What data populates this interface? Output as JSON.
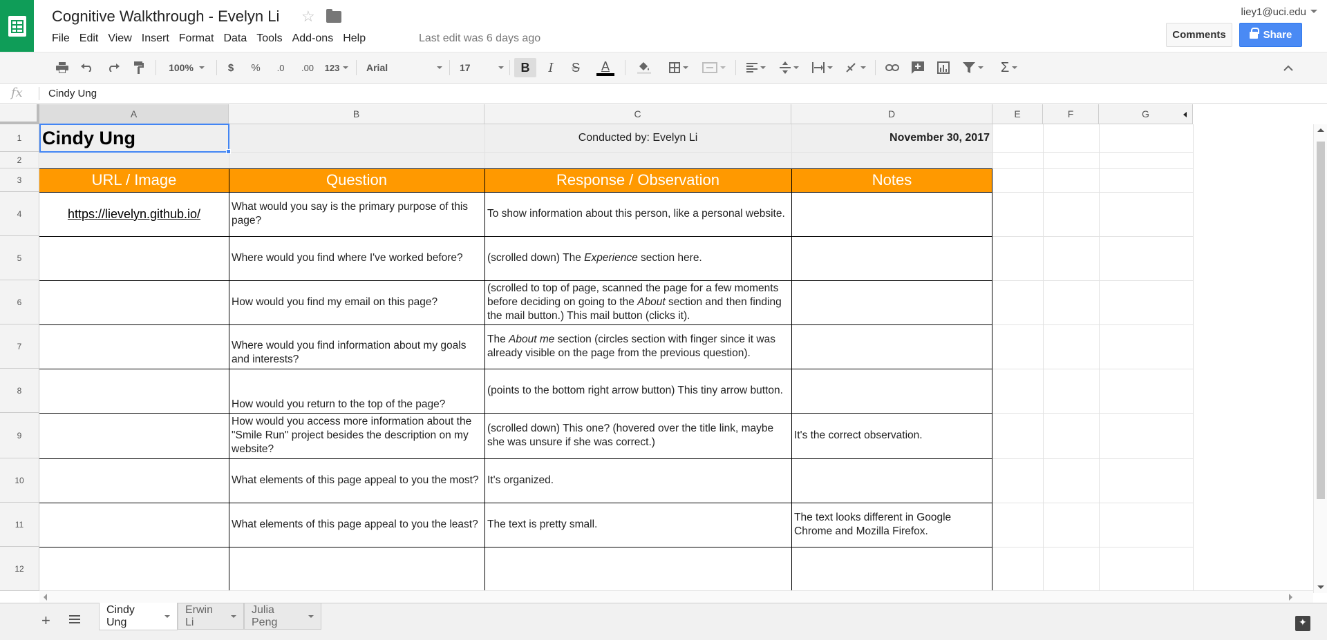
{
  "window": {
    "doc_title": "Cognitive Walkthrough - Evelyn Li",
    "last_edit": "Last edit was 6 days ago",
    "account": "liey1@uci.edu",
    "comments_label": "Comments",
    "share_label": "Share",
    "brand_color": "#0f9d58",
    "share_color": "#4a8af4"
  },
  "menu": [
    "File",
    "Edit",
    "View",
    "Insert",
    "Format",
    "Data",
    "Tools",
    "Add-ons",
    "Help"
  ],
  "toolbar": {
    "zoom": "100%",
    "currency": "$",
    "percent": "%",
    "decrease_decimal": ".0",
    "increase_decimal": ".00",
    "more_formats": "123",
    "font": "Arial",
    "font_size": "17",
    "bold": "B",
    "italic": "I",
    "strikethrough": "S",
    "text_color": "A",
    "bold_active": true
  },
  "formula_bar": {
    "fx": "fx",
    "value": "Cindy Ung"
  },
  "columns": [
    "A",
    "B",
    "C",
    "D",
    "E",
    "F",
    "G"
  ],
  "rows": [
    "1",
    "2",
    "3",
    "4",
    "5",
    "6",
    "7",
    "8",
    "9",
    "10",
    "11",
    "12"
  ],
  "sheet": {
    "title": "Cindy Ung",
    "conducted_by": "Conducted by: Evelyn Li",
    "date": "November 30, 2017",
    "headers": [
      "URL / Image",
      "Question",
      "Response / Observation",
      "Notes"
    ],
    "header_color": "#ff9900",
    "url": "https://lievelyn.github.io/",
    "questions": [
      "What would you say is the primary purpose of this page?",
      "Where would you find where I've worked before?",
      "How would you find my email on this page?",
      "Where would you find information about my goals and interests?",
      "How would you return to the top of the page?",
      "How would you access more information about the \"Smile Run\" project besides the description on my website?",
      "What elements of this page appeal to you the most?",
      "What elements of this page appeal to you the least?",
      ""
    ],
    "responses": {
      "r4": "To show information about this person, like a personal website.",
      "r5_a": "(scrolled down) The ",
      "r5_em": "Experience",
      "r5_b": " section here.",
      "r6_a": "(scrolled to top of page, scanned the page for a few moments before deciding on going to the ",
      "r6_em": "About",
      "r6_b": " section and then finding the mail button.) This mail button (clicks it).",
      "r7_a": "The ",
      "r7_em": "About me",
      "r7_b": " section (circles section with finger since it was already visible on the page from the previous question).",
      "r8": "(points to the bottom right arrow button) This tiny arrow button.",
      "r9": "(scrolled down) This one? (hovered over the title link, maybe she was unsure if she was correct.)",
      "r10": "It's organized.",
      "r11": "The text is pretty small."
    },
    "notes": {
      "r9": "It's the correct observation.",
      "r11": "The text looks different in Google Chrome and Mozilla Firefox."
    }
  },
  "tabs": [
    "Cindy Ung",
    "Erwin Li",
    "Julia Peng"
  ]
}
